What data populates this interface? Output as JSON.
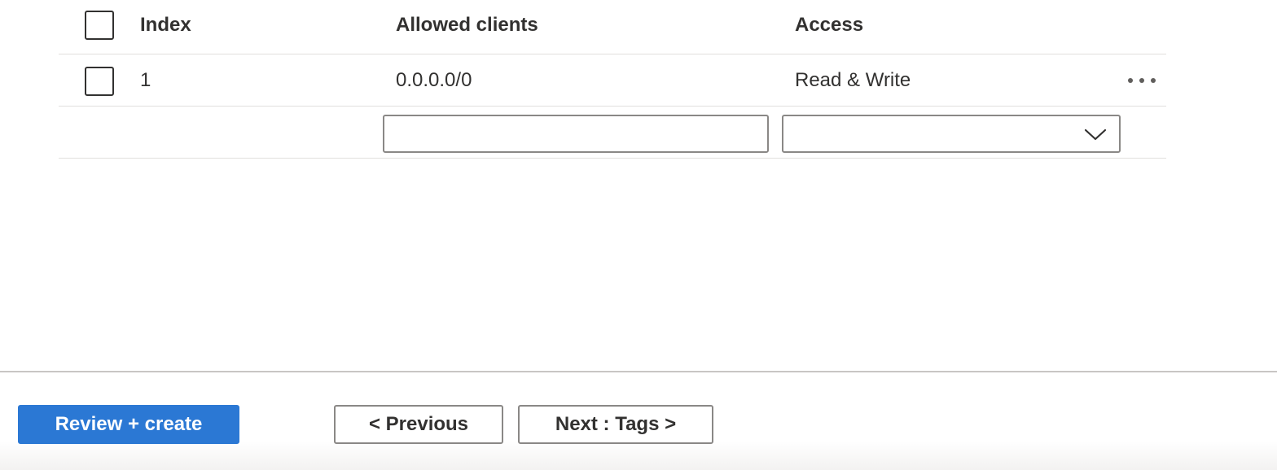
{
  "table": {
    "headers": {
      "index": "Index",
      "allowed_clients": "Allowed clients",
      "access": "Access"
    },
    "rows": [
      {
        "index": "1",
        "allowed_clients": "0.0.0.0/0",
        "access": "Read & Write"
      }
    ],
    "new_row": {
      "allowed_clients_value": "",
      "access_value": ""
    }
  },
  "icons": {
    "more": "more-options-icon",
    "chevron": "chevron-down-icon"
  },
  "footer": {
    "review_create_label": "Review + create",
    "previous_label": "< Previous",
    "next_label": "Next : Tags >"
  },
  "colors": {
    "primary": "#2b78d4",
    "border": "#8a8886",
    "text": "#323130"
  }
}
